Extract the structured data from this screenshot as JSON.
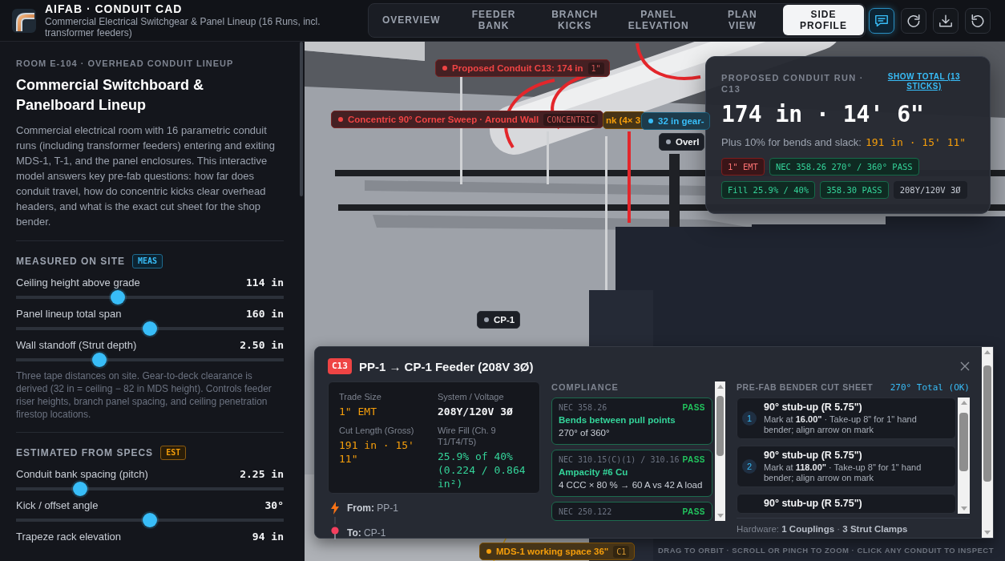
{
  "header": {
    "title": "AIFAB · CONDUIT CAD",
    "subtitle": "Commercial Electrical Switchgear & Panel Lineup (16 Runs, incl. transformer feeders)"
  },
  "tabs": [
    {
      "label": "OVERVIEW",
      "selected": false
    },
    {
      "label": "FEEDER BANK",
      "selected": false
    },
    {
      "label": "BRANCH KICKS",
      "selected": false
    },
    {
      "label": "PANEL ELEVATION",
      "selected": false
    },
    {
      "label": "PLAN VIEW",
      "selected": false
    },
    {
      "label": "SIDE PROFILE",
      "selected": true
    }
  ],
  "toolbar": [
    {
      "kind": "chat",
      "on": true
    },
    {
      "kind": "refresh",
      "on": false
    },
    {
      "kind": "download",
      "on": false
    },
    {
      "kind": "reset",
      "on": false
    }
  ],
  "sidebar": {
    "eyebrow": "ROOM E-104 · OVERHEAD CONDUIT LINEUP",
    "title": "Commercial Switchboard & Panelboard Lineup",
    "description": "Commercial electrical room with 16 parametric conduit runs (including transformer feeders) entering and exiting MDS-1, T-1, and the panel enclosures. This interactive model answers key pre-fab questions: how far does conduit travel, how do concentric kicks clear overhead headers, and what is the exact cut sheet for the shop bender.",
    "sections": [
      {
        "title": "MEASURED ON SITE",
        "badge": "MEAS",
        "kind": "measured",
        "sliders": [
          {
            "label": "Ceiling height above grade",
            "value": "114 in",
            "level": 0.38
          },
          {
            "label": "Panel lineup total span",
            "value": "160 in",
            "level": 0.5
          },
          {
            "label": "Wall standoff (Strut depth)",
            "value": "2.50 in",
            "level": 0.31
          }
        ],
        "note": "Three tape distances on site. Gear-to-deck clearance is derived (32 in = ceiling − 82 in MDS height). Controls feeder riser heights, branch panel spacing, and ceiling penetration firestop locations."
      },
      {
        "title": "ESTIMATED FROM SPECS",
        "badge": "EST",
        "kind": "estimated",
        "sliders": [
          {
            "label": "Conduit bank spacing (pitch)",
            "value": "2.25 in",
            "level": 0.24
          },
          {
            "label": "Kick / offset angle",
            "value": "30°",
            "level": 0.5
          },
          {
            "label": "Trapeze rack elevation",
            "value": "94 in"
          }
        ]
      }
    ]
  },
  "scene": {
    "labels": [
      {
        "text": "Proposed Conduit C13: 174 in",
        "tag": "1\"",
        "kind": "tinted",
        "color": "#ef4444",
        "dot": true
      },
      {
        "text": "Concentric 90° Corner Sweep · Around Wall",
        "tag": "CONCENTRIC",
        "kind": "tinted",
        "color": "#ef4444",
        "dot": true
      },
      {
        "text": "nk (4× 3",
        "kind": "tinted",
        "color": "#f59e0b",
        "dot": false
      },
      {
        "text": "32 in gear-",
        "kind": "tinted",
        "color": "#38bdf8",
        "dot": true
      },
      {
        "text": "Overl",
        "kind": "plain",
        "color": "#9ca3af",
        "dot": true
      },
      {
        "text": "CP-1",
        "kind": "plain",
        "color": "#9ca3af",
        "dot": true
      },
      {
        "text": "MDS-1 working space 36\"",
        "tag": "C1",
        "kind": "tinted",
        "color": "#f59e0b",
        "dot": true
      }
    ],
    "hint": "DRAG TO ORBIT · SCROLL OR PINCH TO ZOOM · CLICK ANY CONDUIT TO INSPECT"
  },
  "run_panel": {
    "eyebrow": "PROPOSED CONDUIT RUN · C13",
    "link": "SHOW TOTAL (13 STICKS)",
    "length": "174 in · 14' 6\"",
    "allowance_label": "Plus 10% for bends and slack:",
    "allowance_value": "191 in · 15' 11\"",
    "chips": [
      {
        "text": "1\" EMT",
        "kind": "alert"
      },
      {
        "text": "NEC 358.26 270° / 360° PASS",
        "kind": "pass"
      },
      {
        "text": "Fill 25.9% / 40%",
        "kind": "pass"
      },
      {
        "text": "358.30 PASS",
        "kind": "pass"
      },
      {
        "text": "208Y/120V 3Ø",
        "kind": "info"
      }
    ]
  },
  "detail": {
    "tag": "C13",
    "title": "PP-1 → CP-1 Feeder (208V 3Ø)",
    "specs": [
      {
        "label": "Trade Size",
        "value": "1\" EMT",
        "kind": "highlight"
      },
      {
        "label": "System / Voltage",
        "value": "208Y/120V 3Ø",
        "kind": "plain"
      },
      {
        "label": "Cut Length (Gross)",
        "value": "191 in · 15' 11\"",
        "kind": "highlight"
      },
      {
        "label": "Wire Fill (Ch. 9 T1/T4/T5)",
        "value": "25.9% of 40% (0.224 / 0.864 in²)",
        "kind": "pass"
      }
    ],
    "route": [
      {
        "kind": "from",
        "text": "**From:** PP-1"
      },
      {
        "kind": "to",
        "text": "**To:** CP-1"
      }
    ],
    "compliance": {
      "title": "COMPLIANCE",
      "checks": [
        {
          "code": "NEC 358.26",
          "status": "PASS",
          "passed": true,
          "title": "Bends between pull points",
          "detail": "270° of 360°"
        },
        {
          "code": "NEC 310.15(C)(1) / 310.16",
          "status": "PASS",
          "passed": true,
          "title": "Ampacity #6 Cu",
          "detail": "4 CCC × 80 % → 60 A vs 42 A load"
        },
        {
          "code": "NEC 250.122",
          "status": "PASS",
          "passed": true
        }
      ]
    },
    "cut_sheet": {
      "title": "PRE-FAB BENDER CUT SHEET",
      "total": "270° Total (OK)",
      "steps": [
        {
          "number": "1",
          "title": "90° stub-up (R 5.75\")",
          "detail": "Mark at **16.00\"** · Take-up 8\" for 1\" hand bender; align arrow on mark"
        },
        {
          "number": "2",
          "title": "90° stub-up (R 5.75\")",
          "detail": "Mark at **118.00\"** · Take-up 8\" for 1\" hand bender; align arrow on mark"
        },
        {
          "title": "90° stub-up (R 5.75\")"
        }
      ]
    },
    "hardware": "Hardware: **1 Couplings** · **3 Strut Clamps**"
  }
}
